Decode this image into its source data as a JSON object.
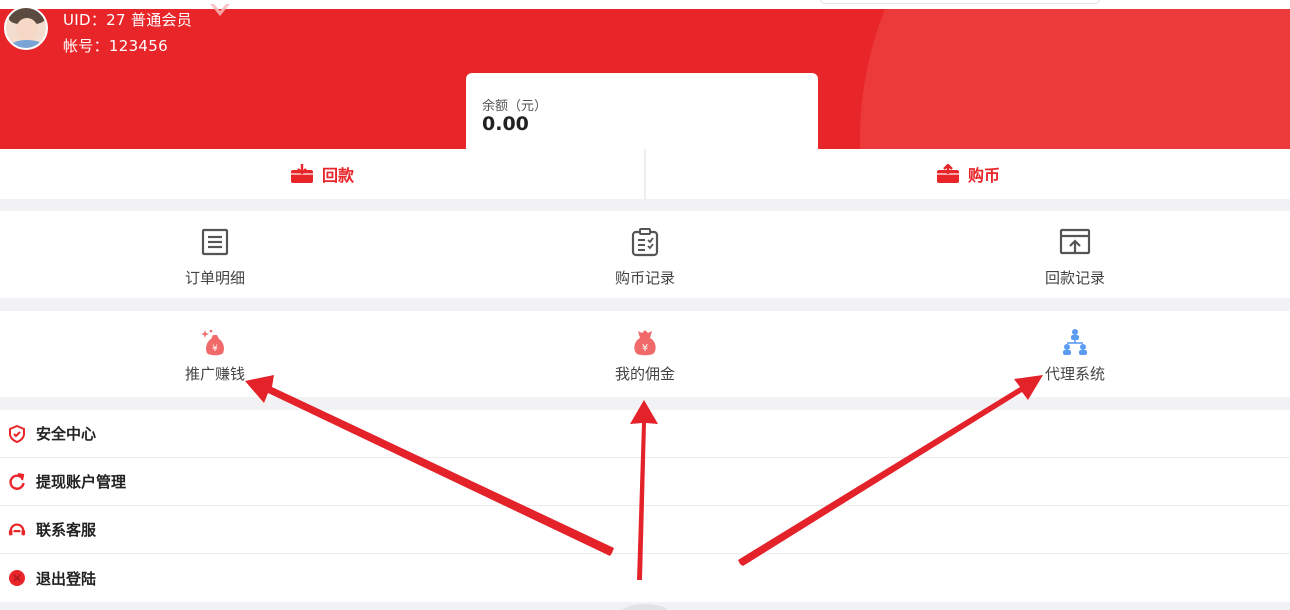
{
  "user": {
    "uid_label": "UID：27 普通会员",
    "account_label": "帐号：123456"
  },
  "balance": {
    "label": "余额（元）",
    "value": "0.00"
  },
  "actions": [
    {
      "label": "回款",
      "icon": "refund-box-icon"
    },
    {
      "label": "购币",
      "icon": "buy-coin-box-icon"
    }
  ],
  "records": [
    {
      "label": "订单明细",
      "icon": "order-list-icon"
    },
    {
      "label": "购币记录",
      "icon": "clipboard-check-icon"
    },
    {
      "label": "回款记录",
      "icon": "upload-window-icon"
    }
  ],
  "features": [
    {
      "label": "推广赚钱",
      "icon": "money-bag-sparkle-icon"
    },
    {
      "label": "我的佣金",
      "icon": "money-bag-icon"
    },
    {
      "label": "代理系统",
      "icon": "org-chart-icon"
    }
  ],
  "menu": [
    {
      "label": "安全中心",
      "icon": "shield-icon"
    },
    {
      "label": "提现账户管理",
      "icon": "refresh-icon"
    },
    {
      "label": "联系客服",
      "icon": "headset-icon"
    },
    {
      "label": "退出登陆",
      "icon": "close-circle-icon"
    }
  ],
  "colors": {
    "brand_red": "#e8262a",
    "arrow_red": "#e3222a",
    "agent_blue": "#5b9bf0",
    "text_gray": "#444444"
  }
}
